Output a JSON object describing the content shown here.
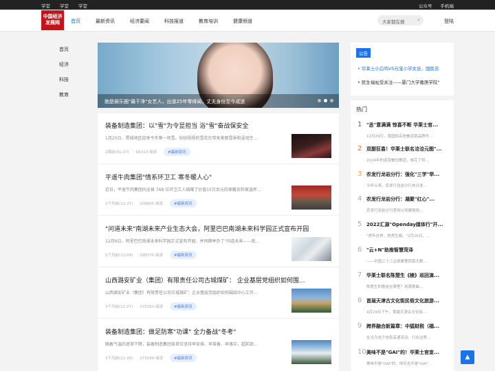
{
  "topbar": {
    "left": [
      "学堂",
      "学堂",
      "学堂"
    ],
    "right": [
      "公众号",
      "手机端"
    ]
  },
  "logo": {
    "line1": "中国经济",
    "line2": "发展网"
  },
  "nav": [
    "首页",
    "最新资讯",
    "经济要闻",
    "科技报道",
    "教育培训",
    "健康频道"
  ],
  "search": {
    "placeholder": "大家都在搜",
    "icon": "search-icon"
  },
  "login": "登陆",
  "leftnav": [
    "首页",
    "经济",
    "科技",
    "教育"
  ],
  "banner": {
    "caption": "她是娱乐圈\"最干净\"女艺人，出道25年零绯闻，丈夫身份至今成迷"
  },
  "articles": [
    {
      "title": "装备制造集团：以\"雪\"为令显担当 浴\"雪\"奋战保安全",
      "summary": "1月25日，晋城地区迎来今冬第一场雪。纷纷扬扬的雪花在带来美丽雪景和湿润空...",
      "time": "2周前(01-27)",
      "reads": "66313 阅读",
      "tag": "#最新资讯"
    },
    {
      "title": "平遥牛肉集团\"情系环卫工 寒冬暖人心\"",
      "summary": "近日，平遥牛肉集团向全县 768 位环卫工人捐赠了价值15万余元的保暖衣和保温杯...",
      "time": "2个月前(12-27)",
      "reads": "206665 阅读",
      "tag": "#最新资讯"
    },
    {
      "title": "\"问道未来\"南湖未来产业生态大会，阿里巴巴南湖未来科学园正式宣布开园",
      "summary": "12月6日，阿里巴巴南湖未来科学园正式宣布开园，并同期举办了\"问道未来——南...",
      "time": "2个月前(12-09)",
      "reads": "298370 阅读",
      "tag": "#最新资讯"
    },
    {
      "title": "山西潞安矿业（集团）有限责任公司古城煤矿：  企业基层党组织如何围...",
      "summary": "山西潞安矿业（集团）有限责任公司古城煤矿：企业基层党组织如何围绕中心工作...",
      "time": "3个月前(11-27)",
      "reads": "370263 阅读",
      "tag": "#最新资讯"
    },
    {
      "title": "装备制造集团：做足防寒\"功课\" 全力备战\"冬考\"",
      "summary": "随着气温的逐渐下降，装备制造集团各单位坚持早安排、早准备、早落实，超前部...",
      "time": "3个月前(11-26)",
      "reads": "373299 阅读",
      "tag": "#最新资讯"
    }
  ],
  "notice": {
    "label": "公告",
    "items": [
      "华莱士小白鸡VS元宝小学女足，国民吉",
      "民生福祉受关注——厦门大学嘉庚学院\""
    ]
  },
  "hot": {
    "title": "热门",
    "items": [
      {
        "n": "1",
        "title": "\"丞\"意满满 惊喜不断 华莱士官...",
        "sub": "12月29日，我国知名快餐连锁品牌华..."
      },
      {
        "n": "2",
        "title": "双厨狂喜！华莱士联名洽洽元图\"...",
        "sub": "2024年的连锁餐饮赛道，卷完了供..."
      },
      {
        "n": "3",
        "title": "农发行龙岩分行：强化\"三学\"举...",
        "sub": "今年以来，农发行龙岩分行充分发..."
      },
      {
        "n": "4",
        "title": "农发行龙岩分行：凝聚\"红心\"...",
        "sub": "农发行龙岩分行坚持以党建强党..."
      },
      {
        "n": "5",
        "title": "2022汇源\"Openday媒体行\"开...",
        "sub": "\"虎年吉祥，虎虎生威。\"2月26日，..."
      },
      {
        "n": "6",
        "title": "\"云+N\"助推智慧菏泽",
        "sub": "——中国二十二冶承建曹西南大数..."
      },
      {
        "n": "7",
        "title": "华莱士联名陈楚生《棱》巡回演...",
        "sub": "陈楚生的歌迷在哪里？用首歌曲..."
      },
      {
        "n": "8",
        "title": "首届天津古文化街民俗文化旅游...",
        "sub": "4月29日下午，首届天津古文化街..."
      },
      {
        "n": "9",
        "title": "跨界融合新篇章：中狐财税（福...",
        "sub": "在当今这个信息高速流动、行业边界..."
      },
      {
        "n": "10",
        "title": "美味不是\"GAI\"的！华莱士官宣...",
        "sub": "美味不是\"GAI\"的，快乐也不是\"GAI\"..."
      }
    ]
  },
  "colors": {
    "accent": "#1a73e8",
    "brand": "#c0151b",
    "rank1": "#e0352b",
    "rank2": "#f0702c",
    "rank3": "#f5a623"
  }
}
